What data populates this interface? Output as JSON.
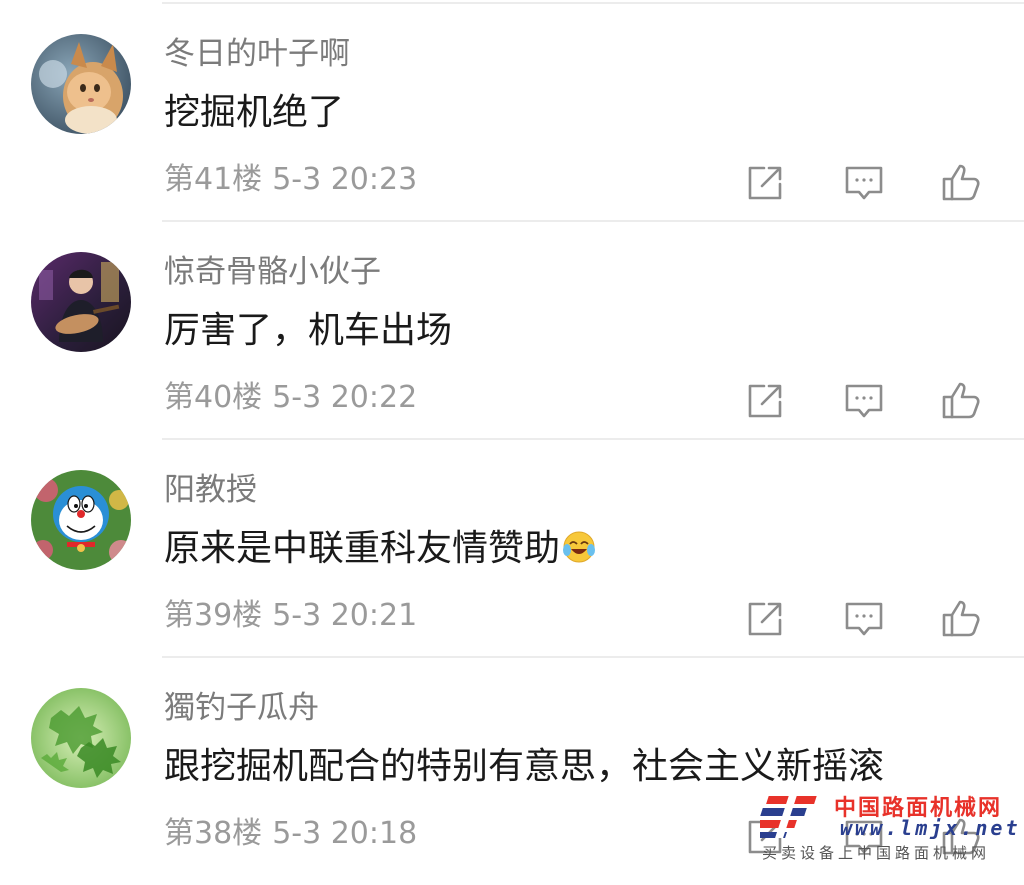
{
  "comments": [
    {
      "username": "冬日的叶子啊",
      "text": "挖掘机绝了",
      "floor": "第41楼",
      "time": "5-3 20:23",
      "avatar": "cat-photo-avatar"
    },
    {
      "username": "惊奇骨骼小伙子",
      "text": "厉害了，机车出场",
      "floor": "第40楼",
      "time": "5-3 20:22",
      "avatar": "guitarist-photo-avatar"
    },
    {
      "username": "阳教授",
      "text": "原来是中联重科友情赞助",
      "floor": "第39楼",
      "time": "5-3 20:21",
      "avatar": "doraemon-avatar",
      "emoji": "laughing-crying-emoji"
    },
    {
      "username": "獨钓子瓜舟",
      "text": "跟挖掘机配合的特别有意思，社会主义新摇滚",
      "floor": "第38楼",
      "time": "5-3 20:18",
      "avatar": "green-leaves-avatar"
    }
  ],
  "actions": {
    "share_icon": "share-icon",
    "reply_icon": "comment-icon",
    "like_icon": "thumbs-up-icon"
  },
  "watermark": {
    "cn_name": "中国路面机械网",
    "url": "www.lmjx.net",
    "tagline": "买卖设备上中国路面机械网"
  },
  "colors": {
    "username": "#7b7b7b",
    "content": "#1a1a1a",
    "meta": "#9a9a9a",
    "divider": "#ececec",
    "watermark_red": "#e8322a",
    "watermark_blue": "#2a3f8f"
  }
}
